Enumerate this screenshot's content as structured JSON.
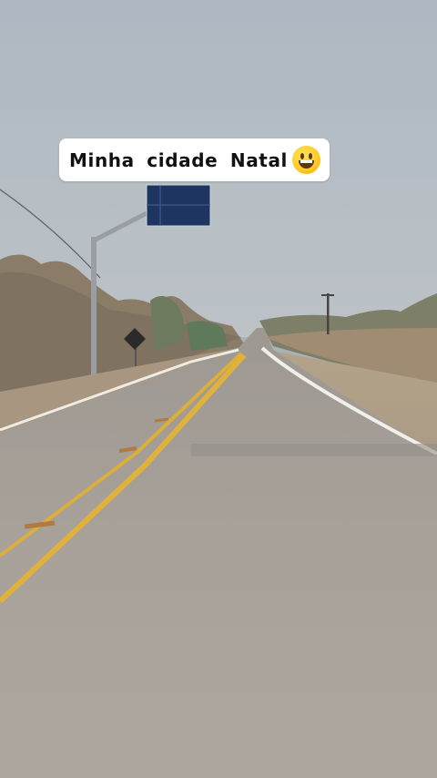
{
  "caption": {
    "text": "Minha cidade Natal",
    "emoji": "grinning-face-emoji"
  },
  "colors": {
    "sky_top": "#b4bec7",
    "sky_bottom": "#b9c0c5",
    "road": "#a59f97",
    "center_line": "#e3b43a",
    "edge_line": "#f1efe9",
    "vegetation": "#8e7d68",
    "sign_panel": "#1d3560"
  }
}
